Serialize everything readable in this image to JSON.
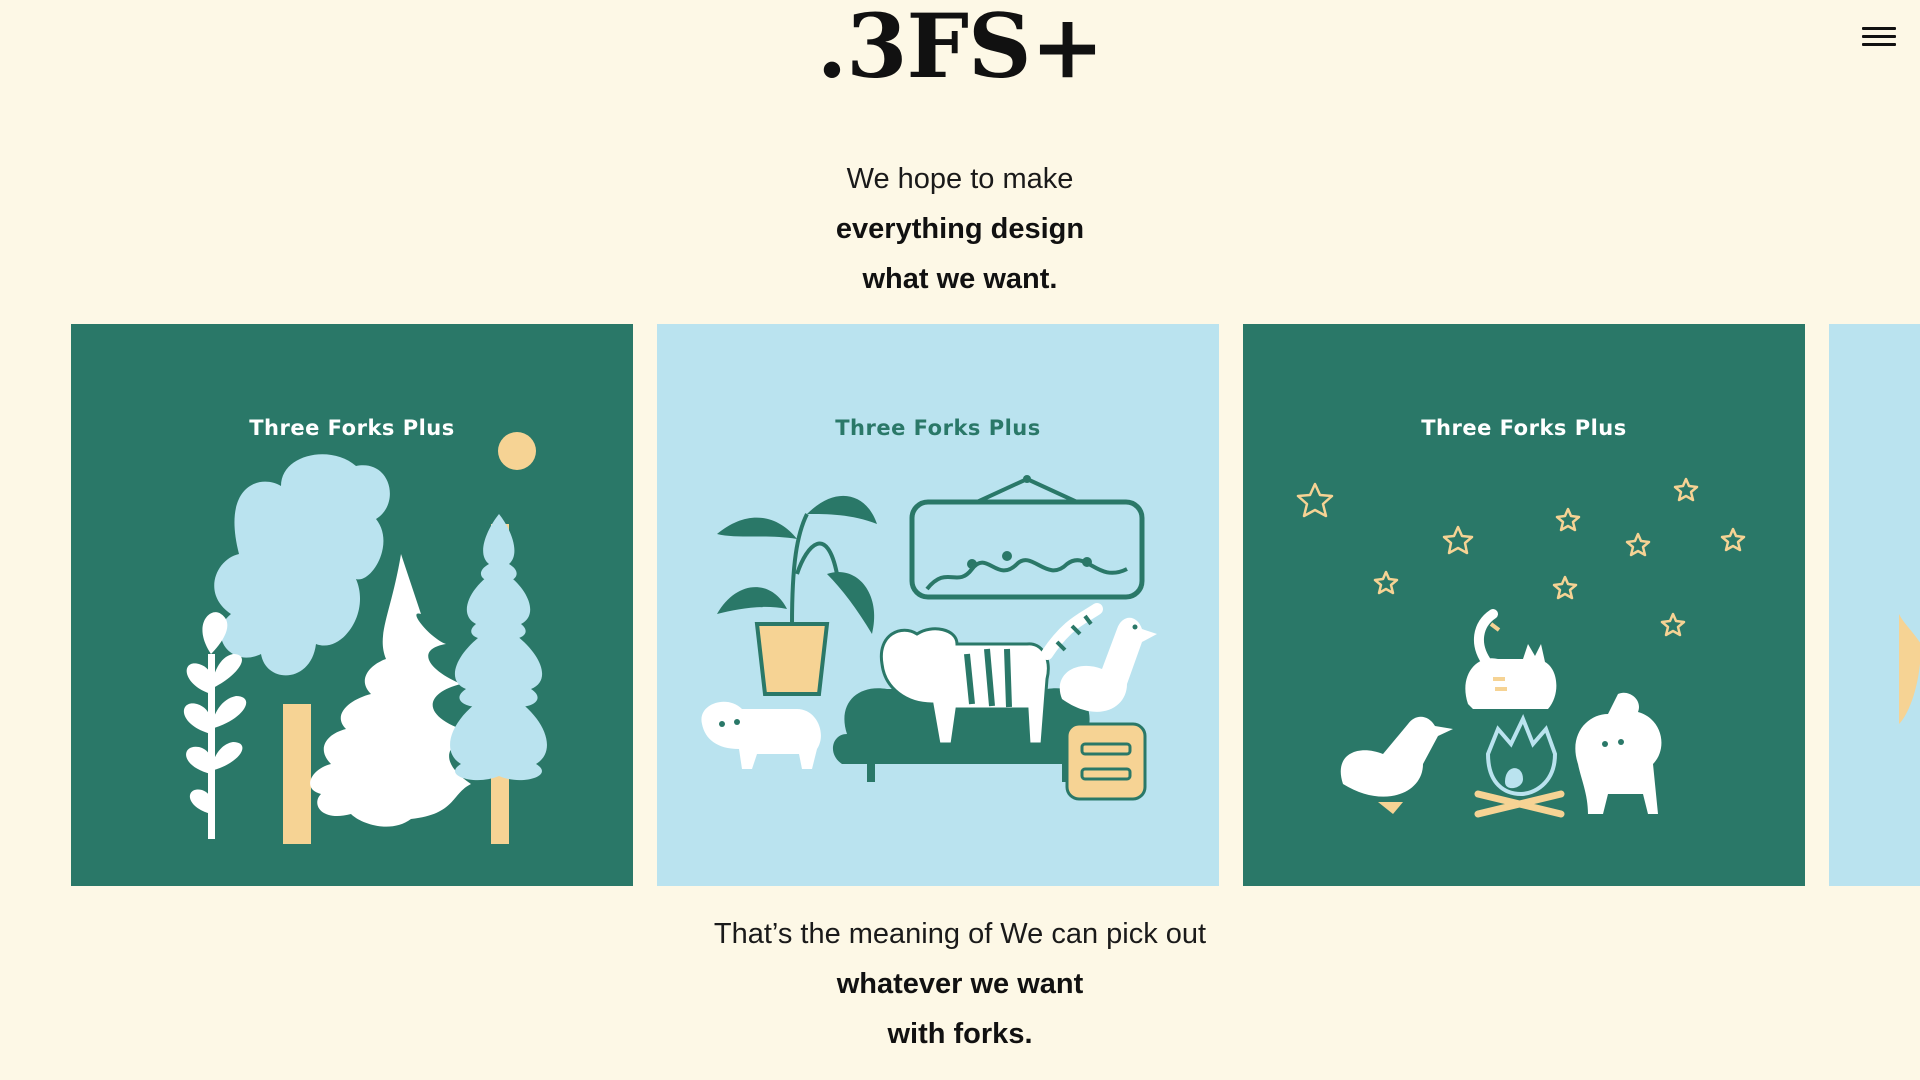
{
  "header": {
    "logo": ".3FS+",
    "menu_icon": "hamburger-menu-icon"
  },
  "intro": {
    "line1": "We hope to make",
    "line2": "everything design",
    "line3": "what we want."
  },
  "carousel": {
    "cards": [
      {
        "title": "Three Forks Plus",
        "theme": "forest",
        "bg": "#2a7868"
      },
      {
        "title": "Three Forks Plus",
        "theme": "living-room",
        "bg": "#bae3ef"
      },
      {
        "title": "Three Forks Plus",
        "theme": "campfire",
        "bg": "#2a7868"
      }
    ],
    "partial_card_bg": "#bae3ef"
  },
  "outro": {
    "line1": "That’s the meaning of We can pick out",
    "line2": "whatever we want",
    "line3": "with forks."
  },
  "colors": {
    "background": "#fdf8e6",
    "teal": "#2a7868",
    "sky": "#bae3ef",
    "sand": "#f6d394",
    "white": "#ffffff"
  }
}
